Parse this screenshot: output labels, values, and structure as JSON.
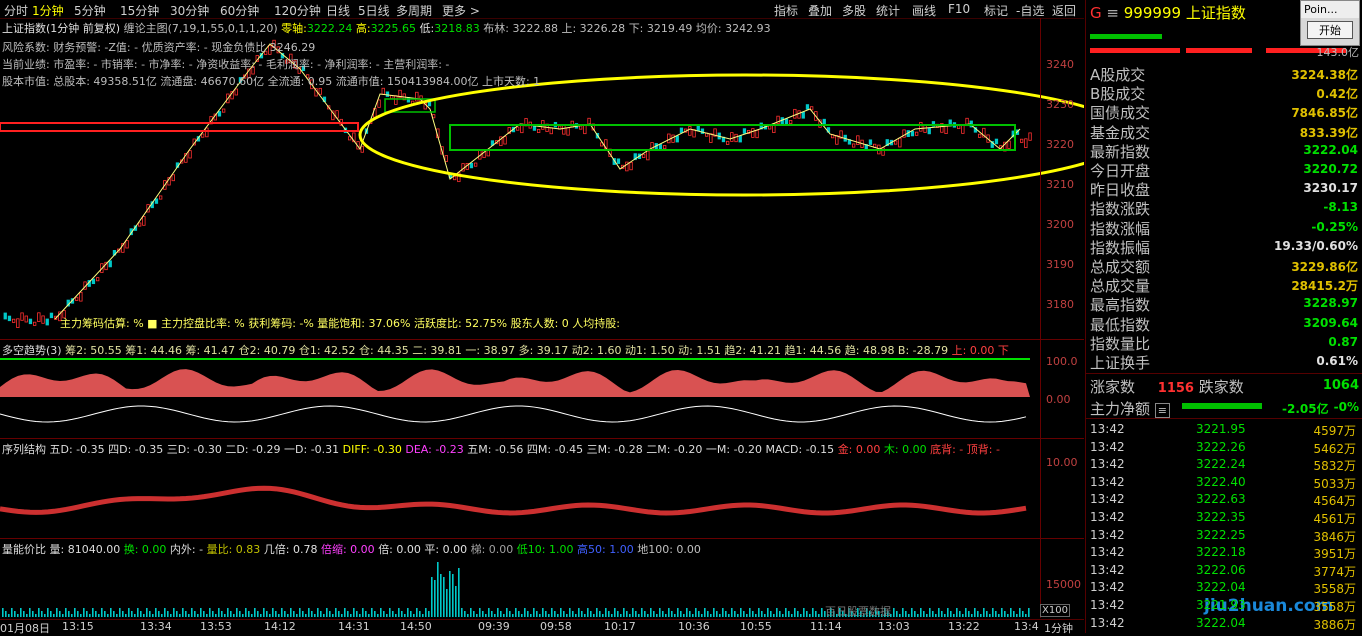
{
  "topbar": {
    "periods": [
      "分时",
      "1分钟",
      "5分钟",
      "15分钟",
      "30分钟",
      "60分钟",
      "120分钟",
      "日线",
      "5日线",
      "多周期",
      "更多 >"
    ],
    "active_period": "1分钟",
    "tools": [
      "指标",
      "叠加",
      "多股",
      "统计",
      "画线",
      "F10",
      "标记",
      "-自选",
      "返回"
    ]
  },
  "info": {
    "line1_title": "上证指数(1分钟 前复权)",
    "line1_rest": "缠论主图(7,19,1,55,0,1,1,20)",
    "zero_axis_label": "零轴:",
    "zero_axis_value": "3222.24",
    "high_label": "高:",
    "high_value": "3225.65",
    "low_label": "低:",
    "low_value": "3218.83",
    "boll_label": "布林: 3222.88",
    "upper_label": "上: 3226.28",
    "lower_label": "下: 3219.49",
    "avg_label": "均价: 3242.93",
    "line2": "风险系数: 财务预警: -Z值: - 优质资产率: - 现金负债比",
    "line2_extra": "3246.29",
    "line3": "当前业绩: 市盈率: - 市销率: - 市净率: - 净资收益率: - 毛利润率: - 净利润率: - 主营利润率: -",
    "line4": "股本市值: 总股本: 49358.51亿 流通盘: 46670.60亿 全流通: 0.95 流通市值: 150413984.00亿 上市天数: 1",
    "bottom_text": "主力筹码估算:          %  ■ 主力控盘比率:          %       获利筹码: -%      量能饱和: 37.06%   活跃度比: 52.75%    股东人数:           0 人均持股:"
  },
  "price_axis": [
    "3240",
    "3230",
    "3220",
    "3210",
    "3200",
    "3190",
    "3180"
  ],
  "ind1": {
    "title": "多空趋势(3)",
    "text": "筹2: 50.55  筹1: 44.46  筹: 41.47  仓2: 40.79  仓1: 42.52  仓: 44.35  二: 39.81  一: 38.97  多: 39.17  动2: 1.60  动1: 1.50  动: 1.51  趋2: 41.21  趋1: 44.56  趋: 48.98  B: -28.79",
    "tail": "上: 0.00  下",
    "axis": [
      "100.0",
      "0.00"
    ]
  },
  "ind2": {
    "title": "序列结构",
    "text": "五D: -0.35  四D: -0.35  三D: -0.30  二D: -0.29  一D: -0.31",
    "diff": "DIFF: -0.30",
    "dea": "DEA: -0.23",
    "text2": "五M: -0.56  四M: -0.45  三M: -0.28  二M: -0.20  一M: -0.20  MACD: -0.15",
    "gold": "金: 0.00",
    "wood": "木: 0.00",
    "tail": "底背: - 顶背: -",
    "axis": [
      "10.00"
    ]
  },
  "ind3": {
    "title": "量能价比",
    "vol": "量: 81040.00",
    "huan": "换: 0.00",
    "neiwai": "内外: -",
    "liangbi": "量比: 0.83",
    "jibei": "几倍: 0.78",
    "beisuo": "倍缩: 0.00",
    "bei": "倍: 0.00",
    "ping": "平: 0.00",
    "ti": "梯: 0.00",
    "di10": "低10: 1.00",
    "gao50": "高50: 1.00",
    "di": "地100: 0.00",
    "axis": [
      "15000"
    ],
    "unit": "X100"
  },
  "botbar": {
    "ticks": [
      "01月08日",
      "13:15",
      "13:34",
      "13:53",
      "14:12",
      "14:31",
      "14:50",
      "09:39",
      "09:58",
      "10:17",
      "10:36",
      "10:55",
      "11:14",
      "13:03",
      "13:22",
      "13:4"
    ],
    "right": "1分钟",
    "mid_text": "百日股票数据"
  },
  "panel": {
    "code_prefix": "G",
    "code": "999999",
    "name": "上证指数",
    "small_value": "143.0亿",
    "rows": [
      {
        "k": "A股成交",
        "v": "3224.38亿",
        "c": "#e0c000"
      },
      {
        "k": "B股成交",
        "v": "0.42亿",
        "c": "#e0c000"
      },
      {
        "k": "国债成交",
        "v": "7846.85亿",
        "c": "#e0c000"
      },
      {
        "k": "基金成交",
        "v": "833.39亿",
        "c": "#e0c000"
      },
      {
        "k": "最新指数",
        "v": "3222.04",
        "c": "#00e000"
      },
      {
        "k": "今日开盘",
        "v": "3220.72",
        "c": "#00e000"
      },
      {
        "k": "昨日收盘",
        "v": "3230.17",
        "c": "#e0e0e0"
      },
      {
        "k": "指数涨跌",
        "v": "-8.13",
        "c": "#00e000"
      },
      {
        "k": "指数涨幅",
        "v": "-0.25%",
        "c": "#00e000"
      },
      {
        "k": "指数振幅",
        "v": "19.33/0.60%",
        "c": "#e0e0e0"
      },
      {
        "k": "总成交额",
        "v": "3229.86亿",
        "c": "#e0c000"
      },
      {
        "k": "总成交量",
        "v": "28415.2万",
        "c": "#e0c000"
      },
      {
        "k": "最高指数",
        "v": "3228.97",
        "c": "#00e000"
      },
      {
        "k": "最低指数",
        "v": "3209.64",
        "c": "#00e000"
      },
      {
        "k": "指数量比",
        "v": "0.87",
        "c": "#00e000"
      },
      {
        "k": "上证换手",
        "v": "0.61%",
        "c": "#e0e0e0"
      }
    ],
    "up_label": "涨家数",
    "up_value": "1156",
    "down_label": "跌家数",
    "down_value": "1064",
    "netflow_label": "主力净额",
    "netflow_value": "-2.05亿",
    "netflow_pct": "-0%",
    "ticks": [
      {
        "t": "13:42",
        "p": "3221.95",
        "q": "4597万"
      },
      {
        "t": "13:42",
        "p": "3222.26",
        "q": "5462万"
      },
      {
        "t": "13:42",
        "p": "3222.24",
        "q": "5832万"
      },
      {
        "t": "13:42",
        "p": "3222.40",
        "q": "5033万"
      },
      {
        "t": "13:42",
        "p": "3222.63",
        "q": "4564万"
      },
      {
        "t": "13:42",
        "p": "3222.35",
        "q": "4561万"
      },
      {
        "t": "13:42",
        "p": "3222.25",
        "q": "3846万"
      },
      {
        "t": "13:42",
        "p": "3222.18",
        "q": "3951万"
      },
      {
        "t": "13:42",
        "p": "3222.06",
        "q": "3774万"
      },
      {
        "t": "13:42",
        "p": "3222.04",
        "q": "3558万"
      },
      {
        "t": "13:42",
        "p": "3221.93",
        "q": "3558万"
      },
      {
        "t": "13:42",
        "p": "3222.04",
        "q": "3886万"
      }
    ],
    "watermark": "jiu2huan.com"
  },
  "popup": {
    "title": "Poin...",
    "button": "开始"
  },
  "colors": {
    "up": "#ff3030",
    "down": "#00e000",
    "yellow": "#ffff00",
    "bg": "#000000",
    "grid": "#660000"
  }
}
